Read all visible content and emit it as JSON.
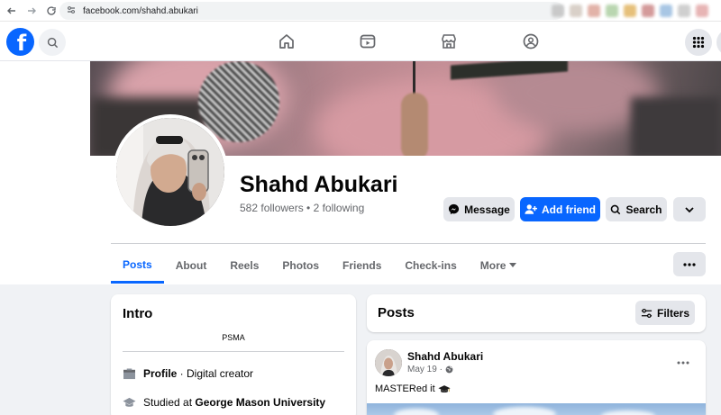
{
  "browser": {
    "url": "facebook.com/shahd.abukari",
    "back_icon": "back-arrow-icon",
    "forward_icon": "forward-arrow-icon",
    "reload_icon": "reload-icon"
  },
  "nav": {
    "logo_letter": "f",
    "icons": [
      "home-icon",
      "video-icon",
      "marketplace-icon",
      "groups-icon",
      "apps-menu-icon"
    ]
  },
  "profile": {
    "name": "Shahd Abukari",
    "stats": "582 followers • 2 following",
    "buttons": {
      "message": "Message",
      "add_friend": "Add friend",
      "search": "Search"
    },
    "tabs": [
      "Posts",
      "About",
      "Reels",
      "Photos",
      "Friends",
      "Check-ins"
    ],
    "more_tab": "More",
    "active_tab": "Posts"
  },
  "intro": {
    "title": "Intro",
    "bio": "PSMA",
    "profile_label": "Profile",
    "profile_value": " · Digital creator",
    "studied_prefix": "Studied at ",
    "studied_school": "George Mason University"
  },
  "posts": {
    "title": "Posts",
    "filters_label": "Filters",
    "post": {
      "author": "Shahd Abukari",
      "date": "May 19 ·",
      "text": "MASTERed it"
    }
  },
  "colors": {
    "brand": "#0866ff",
    "button_gray": "#e4e6eb",
    "text_secondary": "#65676b",
    "background": "#f0f2f5"
  }
}
